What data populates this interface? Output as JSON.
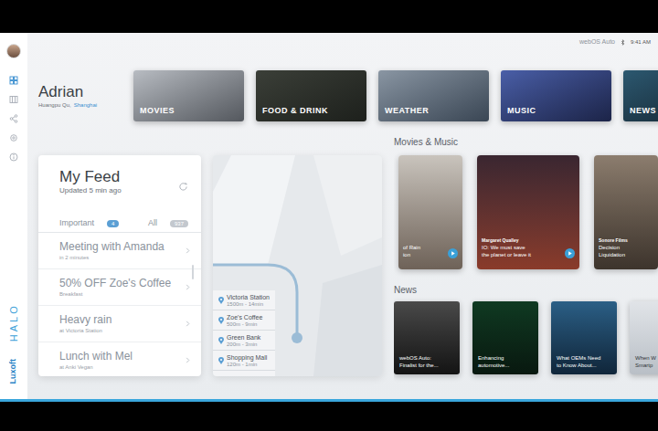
{
  "status_bar": {
    "brand": "webOS Auto",
    "time": "9:41 AM"
  },
  "sidebar": {
    "items": [
      {
        "selected": true
      },
      {
        "selected": false
      },
      {
        "selected": false
      },
      {
        "selected": false
      },
      {
        "selected": false
      }
    ],
    "product": "HALO",
    "logo": "Luxoft"
  },
  "user": {
    "name": "Adrian",
    "district": "Huangpu Qu,",
    "city": "Shanghai"
  },
  "categories": [
    {
      "label": "MOVIES"
    },
    {
      "label": "FOOD & DRINK"
    },
    {
      "label": "WEATHER"
    },
    {
      "label": "MUSIC"
    },
    {
      "label": "NEWS"
    }
  ],
  "feed": {
    "title": "My Feed",
    "updated": "Updated 5 min ago",
    "filters": [
      {
        "label": "Important",
        "count": "4",
        "selected": true
      },
      {
        "label": "All",
        "count": "937",
        "selected": false
      }
    ],
    "items": [
      {
        "title": "Meeting with Amanda",
        "subtitle": "in 2 minutes"
      },
      {
        "title": "50% OFF Zoe's Coffee",
        "subtitle": "Breakfast"
      },
      {
        "title": "Heavy rain",
        "subtitle": "at Victoria Station"
      },
      {
        "title": "Lunch with Mel",
        "subtitle": "at Anki Vegan"
      }
    ]
  },
  "map": {
    "places": [
      {
        "name": "Victoria Station",
        "distance": "1500m - 14min"
      },
      {
        "name": "Zoe's Coffee",
        "distance": "500m - 9min"
      },
      {
        "name": "Green Bank",
        "distance": "200m - 3min"
      },
      {
        "name": "Shopping Mall",
        "distance": "120m - 1min"
      }
    ]
  },
  "movies_music": {
    "title": "Movies & Music",
    "cards": [
      {
        "lines": [
          "of Rain",
          "ion"
        ],
        "playable": true
      },
      {
        "source": "Margaret Qualley",
        "lines": [
          "IO: We must save",
          "the planet or leave it"
        ],
        "playable": true
      },
      {
        "source": "Sonore Films",
        "lines": [
          "Decision",
          "Liquidation"
        ],
        "playable": false
      }
    ]
  },
  "news": {
    "title": "News",
    "cards": [
      {
        "lines": [
          "webOS Auto:",
          "Finalist for the..."
        ]
      },
      {
        "lines": [
          "Enhancing",
          "automotive..."
        ]
      },
      {
        "lines": [
          "What OEMs Need",
          "to Know About..."
        ]
      },
      {
        "lines": [
          "When W",
          "Smartp"
        ]
      }
    ]
  }
}
